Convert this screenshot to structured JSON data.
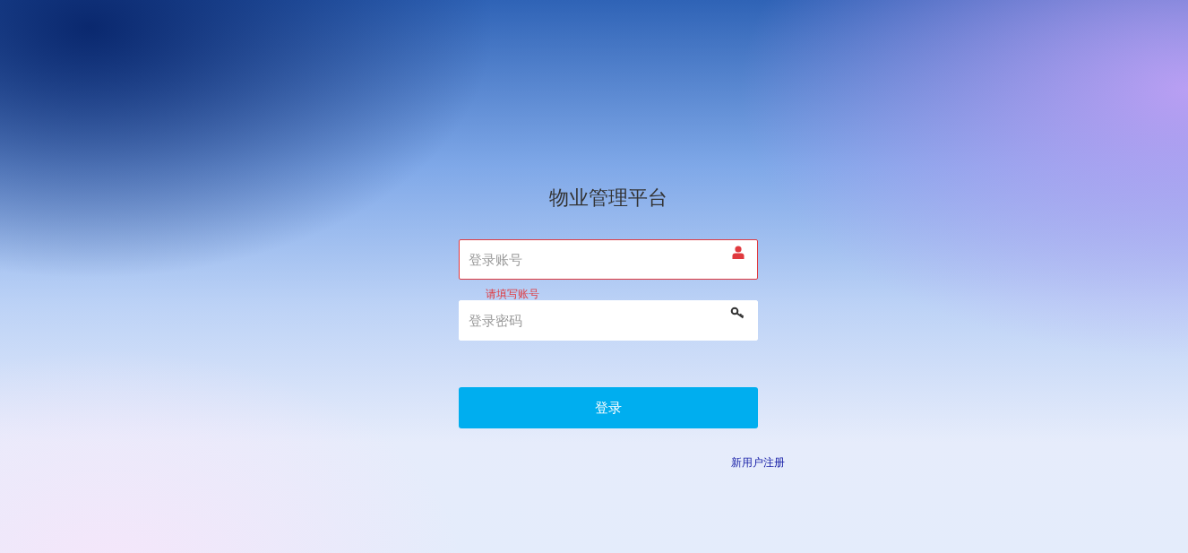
{
  "title": "物业管理平台",
  "fields": [
    {
      "kind": "account",
      "placeholder": "登录账号",
      "invalid": true,
      "error": "请填写账号"
    },
    {
      "kind": "password",
      "placeholder": "登录密码",
      "invalid": false
    }
  ],
  "login_button": "登录",
  "register_link": "新用户注册"
}
